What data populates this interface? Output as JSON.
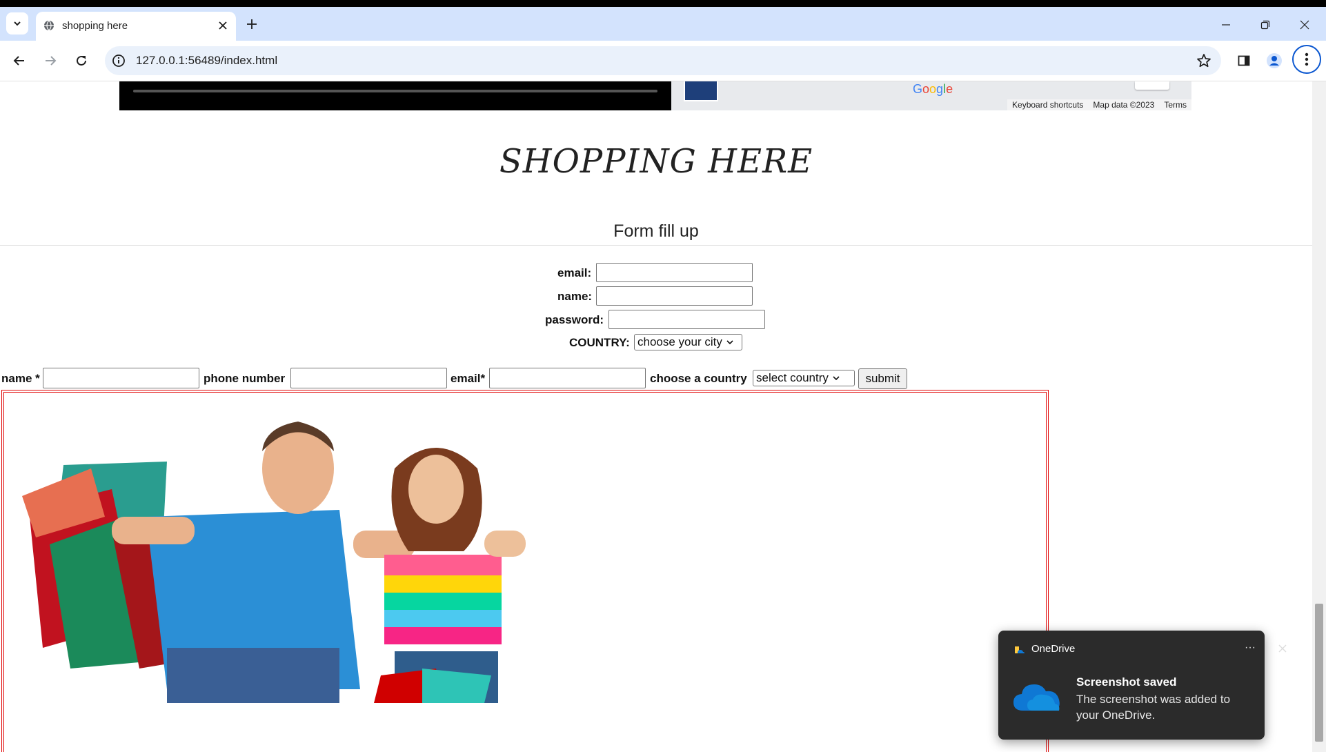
{
  "browser": {
    "tab_title": "shopping here",
    "url": "127.0.0.1:56489/index.html"
  },
  "map": {
    "logo": "Google",
    "attribution": [
      "Keyboard shortcuts",
      "Map data ©2023",
      "Terms"
    ]
  },
  "page": {
    "title": "SHOPPING HERE",
    "form_heading": "Form fill up"
  },
  "form1": {
    "email_label": "email:",
    "name_label": "name:",
    "password_label": "password:",
    "country_label": "COUNTRY:",
    "country_select": "choose your city"
  },
  "form2": {
    "name_label": "name *",
    "phone_label": "phone number",
    "email_label": "email*",
    "country_label": "choose a country",
    "country_select": "select country",
    "submit": "submit"
  },
  "notification": {
    "app": "OneDrive",
    "title": "Screenshot saved",
    "body": "The screenshot was added to your OneDrive.",
    "more": "···"
  },
  "colors": {
    "chrome_tabstrip": "#d3e3fd",
    "omnibox": "#eaf1fb",
    "frame_red": "#e00000",
    "toast_bg": "#2b2b2b",
    "onedrive_blue": "#0f78d4"
  },
  "icons": [
    "tab-search-icon",
    "globe-icon",
    "close-icon",
    "plus-icon",
    "minimize-icon",
    "restore-icon",
    "back-icon",
    "forward-icon",
    "reload-icon",
    "info-icon",
    "star-icon",
    "side-panel-icon",
    "profile-icon",
    "kebab-menu-icon",
    "chevron-down-icon",
    "onedrive-icon",
    "cloud-icon"
  ]
}
